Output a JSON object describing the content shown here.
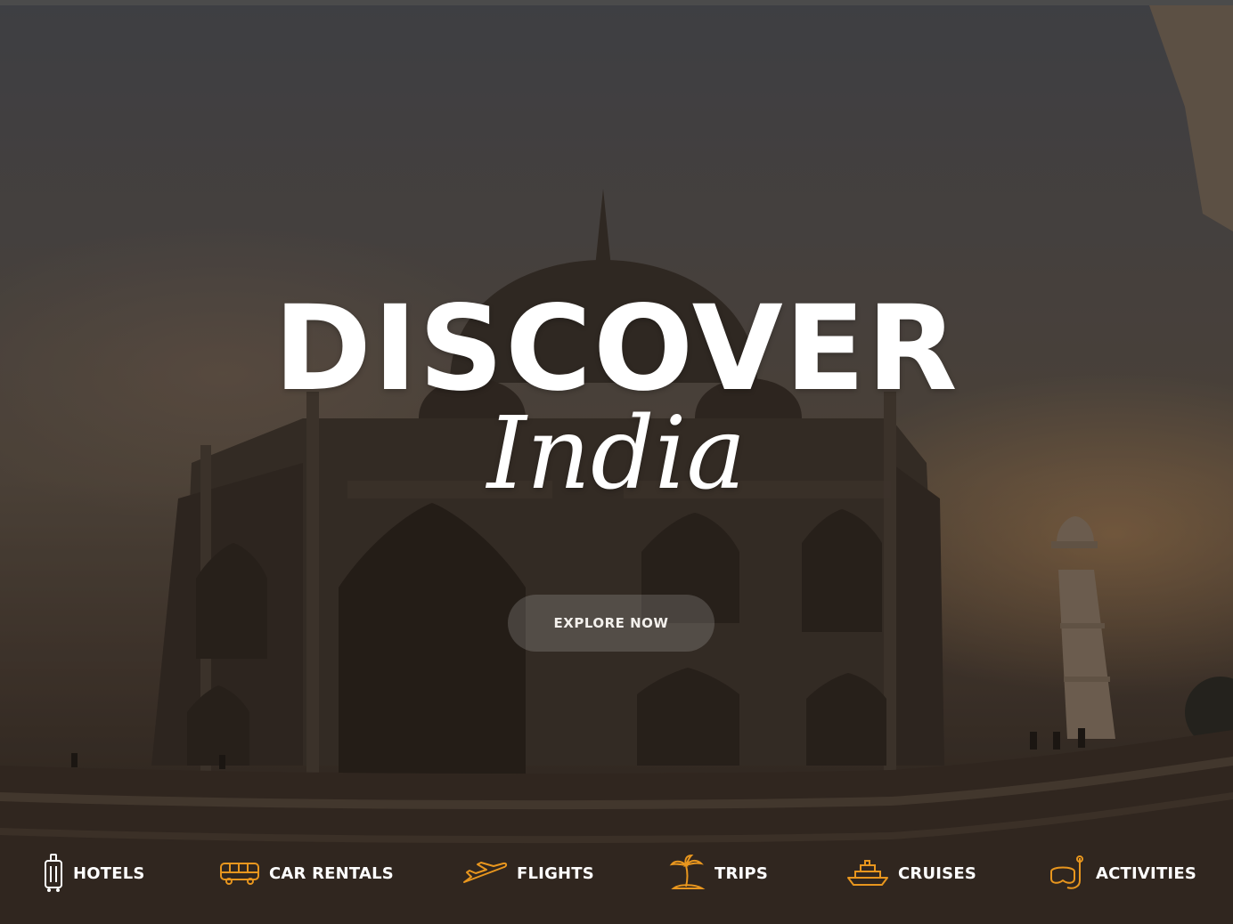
{
  "hero": {
    "title": "DISCOVER",
    "subtitle": "India",
    "cta_label": "EXPLORE NOW"
  },
  "services": [
    {
      "label": "HOTELS",
      "icon": "luggage-icon"
    },
    {
      "label": "CAR RENTALS",
      "icon": "bus-icon"
    },
    {
      "label": "FLIGHTS",
      "icon": "airplane-icon"
    },
    {
      "label": "TRIPS",
      "icon": "palm-island-icon"
    },
    {
      "label": "CRUISES",
      "icon": "ship-icon"
    },
    {
      "label": "ACTIVITIES",
      "icon": "snorkel-mask-icon"
    }
  ],
  "colors": {
    "accent": "#e8961e",
    "text": "#ffffff"
  }
}
